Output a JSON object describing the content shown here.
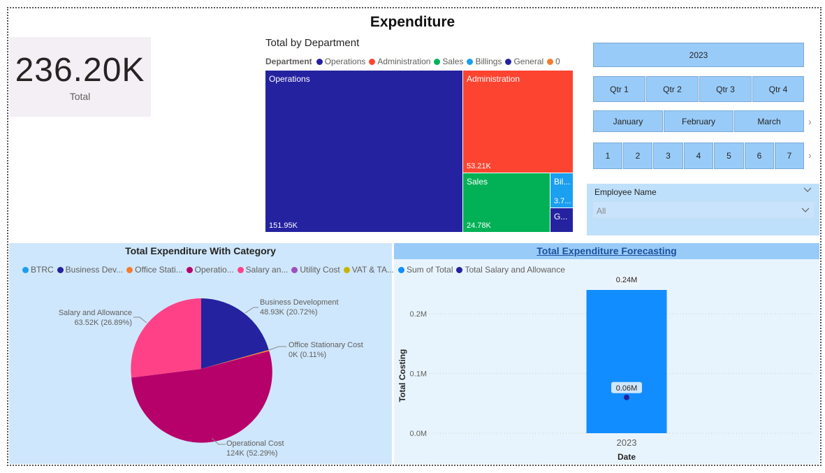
{
  "page": {
    "title": "Expenditure"
  },
  "card": {
    "value": "236.20K",
    "label": "Total"
  },
  "treemap": {
    "title": "Total by Department",
    "legend_title": "Department",
    "legend": [
      {
        "label": "Operations",
        "color": "#2522a0"
      },
      {
        "label": "Administration",
        "color": "#fd4430"
      },
      {
        "label": "Sales",
        "color": "#02b156"
      },
      {
        "label": "Billings",
        "color": "#1b9ff0"
      },
      {
        "label": "General",
        "color": "#2522a0"
      },
      {
        "label": "0",
        "color": "#f47c31"
      }
    ],
    "boxes": [
      {
        "name": "Operations",
        "value": "151.95K",
        "color": "#2522a0"
      },
      {
        "name": "Administration",
        "value": "53.21K",
        "color": "#fd4430"
      },
      {
        "name": "Sales",
        "value": "24.78K",
        "color": "#02b156"
      },
      {
        "name": "Bil...",
        "value": "3.7...",
        "color": "#1b9ff0"
      },
      {
        "name": "G...",
        "value": "",
        "color": "#2522a0"
      }
    ]
  },
  "slicers": {
    "year": "2023",
    "quarters": [
      "Qtr 1",
      "Qtr 2",
      "Qtr 3",
      "Qtr 4"
    ],
    "months": [
      "January",
      "February",
      "March"
    ],
    "days": [
      "1",
      "2",
      "3",
      "4",
      "5",
      "6",
      "7"
    ],
    "next_icon": "chevron-right-icon"
  },
  "employee": {
    "title": "Employee Name",
    "selected": "All"
  },
  "pie": {
    "title": "Total Expenditure With Category",
    "legend": [
      {
        "label": "BTRC",
        "color": "#1b9ff0"
      },
      {
        "label": "Business Dev...",
        "color": "#2522a0"
      },
      {
        "label": "Office Stati...",
        "color": "#f47c31"
      },
      {
        "label": "Operatio...",
        "color": "#b6006a"
      },
      {
        "label": "Salary an...",
        "color": "#ff4187"
      },
      {
        "label": "Utility Cost",
        "color": "#9c4fc0"
      },
      {
        "label": "VAT & TA...",
        "color": "#c8b400"
      }
    ],
    "labels": {
      "business_dev": {
        "name": "Business Development",
        "value": "48.93K (20.72%)"
      },
      "office": {
        "name": "Office Stationary Cost",
        "value": "0K (0.11%)"
      },
      "operational": {
        "name": "Operational Cost",
        "value": "124K (52.29%)"
      },
      "salary": {
        "name": "Salary and Allowance",
        "value": "63.52K (26.89%)"
      }
    }
  },
  "chart_data": {
    "type": "bar",
    "title": "Total Expenditure Forecasting",
    "categories": [
      "2023"
    ],
    "series": [
      {
        "name": "Sum of Total",
        "values": [
          0.24
        ],
        "color": "#118dff",
        "kind": "bar"
      },
      {
        "name": "Total Salary and Allowance",
        "values": [
          0.06
        ],
        "color": "#2522a0",
        "kind": "point"
      }
    ],
    "data_labels": [
      "0.24M",
      "0.06M"
    ],
    "xlabel": "Date",
    "ylabel": "Total Costing",
    "y_ticks": [
      "0.0M",
      "0.1M",
      "0.2M"
    ],
    "ylim": [
      0,
      0.24
    ],
    "legend_position": "top-left",
    "grid": true
  }
}
